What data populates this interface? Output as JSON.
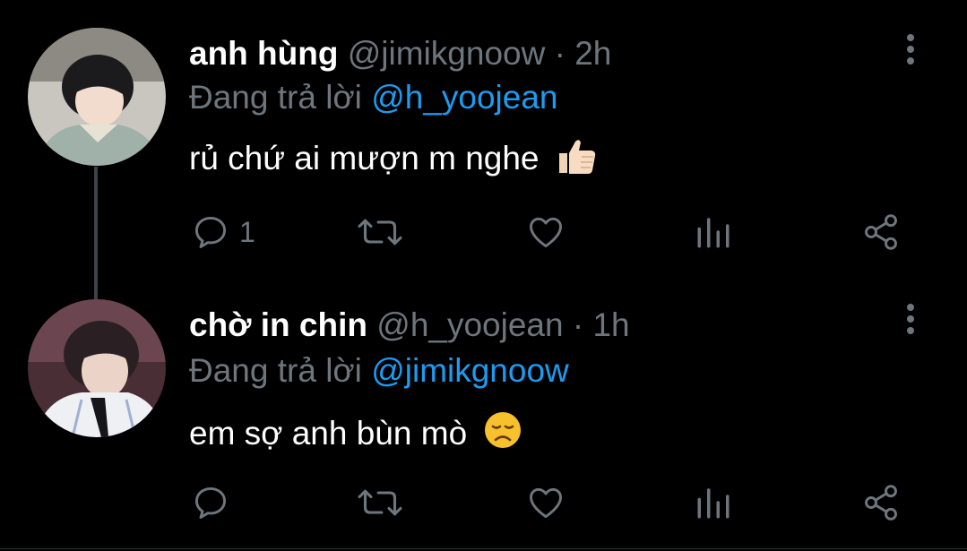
{
  "theme": {
    "background": "#000000",
    "text": "#ffffff",
    "secondary": "#6e767d",
    "accent": "#1d9bf0"
  },
  "tweets": [
    {
      "name": "anh hùng",
      "handle": "@jimikgnoow",
      "separator": "·",
      "time": "2h",
      "replying_prefix": "Đang trả lời",
      "replying_to": "@h_yoojean",
      "text": "rủ chứ ai mượn m nghe",
      "emoji": "thumbs-up",
      "reply_count": "1",
      "icons": [
        "reply-icon",
        "retweet-icon",
        "like-icon",
        "analytics-icon",
        "share-icon",
        "more-icon"
      ]
    },
    {
      "name": "chờ in chin",
      "handle": "@h_yoojean",
      "separator": "·",
      "time": "1h",
      "replying_prefix": "Đang trả lời",
      "replying_to": "@jimikgnoow",
      "text": "em sợ anh bùn mò",
      "emoji": "disappointed-face",
      "reply_count": "",
      "icons": [
        "reply-icon",
        "retweet-icon",
        "like-icon",
        "analytics-icon",
        "share-icon",
        "more-icon"
      ]
    }
  ]
}
